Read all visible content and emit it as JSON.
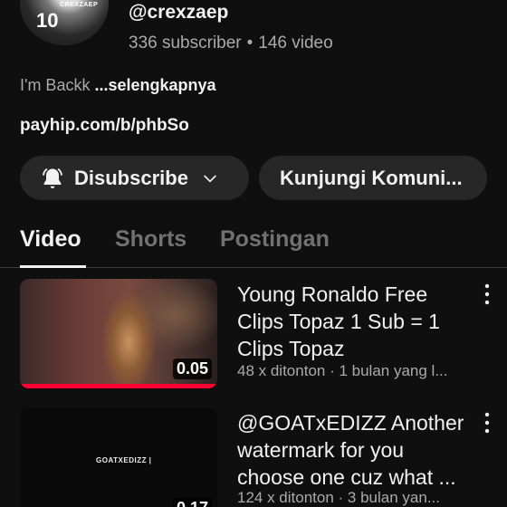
{
  "channel": {
    "avatar_number": "10",
    "avatar_tag": "CREXZAEP",
    "handle": "@crexzaep",
    "subscribers": "336 subscriber",
    "videos": "146 video",
    "separator": "•",
    "description": "I'm Backk ",
    "more_label": "...selengkapnya",
    "link": "payhip.com/b/phbSo"
  },
  "actions": {
    "subscribe_label": "Disubscribe",
    "community_label": "Kunjungi Komuni..."
  },
  "tabs": [
    {
      "label": "Video",
      "active": true
    },
    {
      "label": "Shorts",
      "active": false
    },
    {
      "label": "Postingan",
      "active": false
    }
  ],
  "videos": [
    {
      "title": "Young Ronaldo Free Clips Topaz 1 Sub = 1 Clips Topaz",
      "meta": "48 x ditonton · 1 bulan yang l...",
      "duration": "0.05",
      "watched_fraction": 1.0
    },
    {
      "title": "@GOATxEDIZZ Another watermark for you choose one cuz what ...",
      "meta": "124 x ditonton · 3 bulan yan...",
      "duration": "0.17",
      "watermark": "GOATXEDIZZ  |"
    }
  ]
}
